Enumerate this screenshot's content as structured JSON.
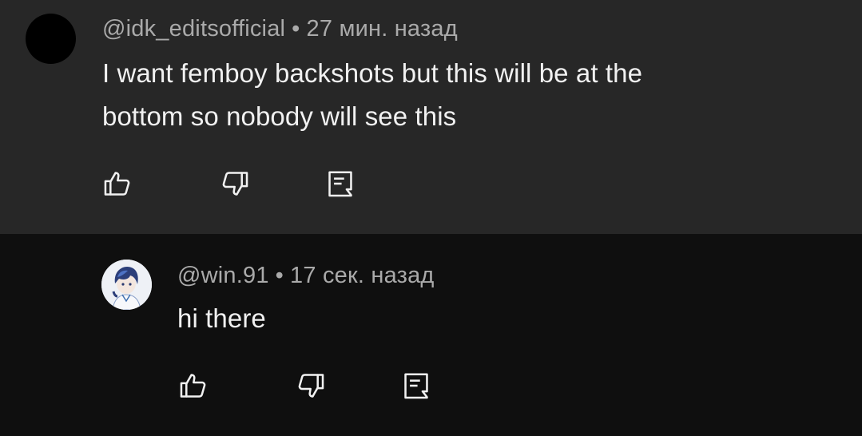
{
  "comments": [
    {
      "handle": "@idk_editsofficial",
      "separator": "•",
      "time": "27 мин. назад",
      "text": "I want femboy backshots but this will be at the\nbottom so nobody will see this",
      "avatar_color": "#000000",
      "actions": [
        "thumb-up-icon",
        "thumb-down-icon",
        "reply-icon"
      ]
    },
    {
      "handle": "@win.91",
      "separator": "•",
      "time": "17 сек. назад",
      "text": "hi there",
      "avatar_description_icon": "anime-avatar-icon",
      "actions": [
        "thumb-up-icon",
        "thumb-down-icon",
        "reply-icon"
      ]
    }
  ],
  "colors": {
    "top_comment_bg": "#272727",
    "reply_bg": "#0f0f0f",
    "meta_text": "#aaaaaa",
    "body_text": "#f1f1f1",
    "icon": "#f1f1f1"
  }
}
